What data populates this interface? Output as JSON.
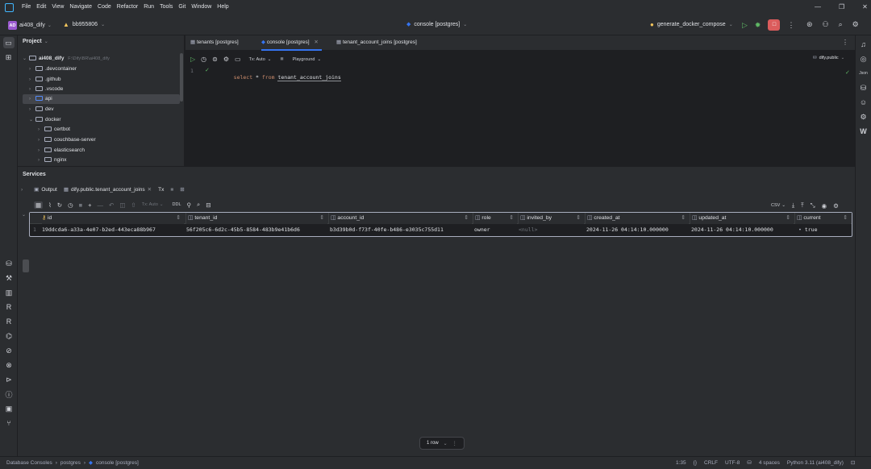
{
  "menu": [
    "File",
    "Edit",
    "View",
    "Navigate",
    "Code",
    "Refactor",
    "Run",
    "Tools",
    "Git",
    "Window",
    "Help"
  ],
  "project_widget": {
    "initials": "AD",
    "name": "ai408_dify"
  },
  "branch_widget": {
    "name": "bb955806"
  },
  "center_title": "console [postgres]",
  "run_config": "generate_docker_compose",
  "project_panel": {
    "title": "Project",
    "root_name": "ai408_dify",
    "root_path": "F:\\Dify\\BR\\ai408_dify",
    "items": [
      ".devcontainer",
      ".github",
      ".vscode",
      "api",
      "dev",
      "docker",
      "certbot",
      "couchbase-server",
      "elasticsearch",
      "nginx"
    ]
  },
  "editor": {
    "tabs": [
      "tenants [postgres]",
      "console [postgres]",
      "tenant_account_joins [postgres]"
    ],
    "toolbar": {
      "tx": "Tx: Auto",
      "playground": "Playground",
      "schema": "dify.public"
    },
    "line_number": "1",
    "code": {
      "kw1": "select",
      "star": " * ",
      "kw2": "from",
      "table": "tenant_account_joins"
    }
  },
  "services": {
    "title": "Services",
    "tabs": [
      "Output",
      "dify.public.tenant_account_joins",
      "Tx"
    ],
    "toolbar": {
      "tx": "Tx: Auto",
      "ddl": "DDL",
      "csv": "CSV"
    },
    "columns": [
      "id",
      "tenant_id",
      "account_id",
      "role",
      "invited_by",
      "created_at",
      "updated_at",
      "current"
    ],
    "rows": [
      {
        "num": "1",
        "id": "19ddcda6-a33a-4e07-b2ed-443eca88b967",
        "tenant_id": "56f205c6-6d2c-45b5-8584-483b9e41b6d6",
        "account_id": "b3d39b0d-f73f-40fe-b486-e3035c755d11",
        "role": "owner",
        "invited_by": "<null>",
        "created_at": "2024-11-26 04:14:10.000000",
        "updated_at": "2024-11-26 04:14:10.000000",
        "current": "true"
      }
    ],
    "row_count": "1 row"
  },
  "statusbar": {
    "breadcrumb": [
      "Database Consoles",
      "postgres",
      "console [postgres]"
    ],
    "position": "1:35",
    "line_sep": "CRLF",
    "encoding": "UTF-8",
    "indent": "4 spaces",
    "interpreter": "Python 3.11 (ai408_dify)"
  },
  "colors": {
    "accent": "#3574f0",
    "keyword": "#cf8e6d",
    "run": "#5fb865",
    "stop": "#db5c5c"
  }
}
